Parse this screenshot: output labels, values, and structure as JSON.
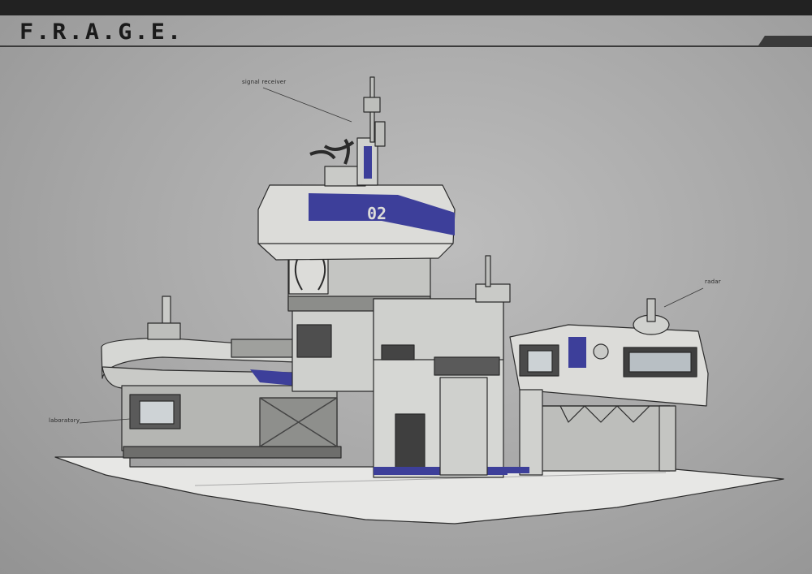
{
  "header": {
    "title": "F.R.A.G.E."
  },
  "building": {
    "module_number": "02"
  },
  "callouts": {
    "signal_receiver": "signal receiver",
    "radar": "radar",
    "laboratory": "laboratory"
  },
  "colors": {
    "accent": "#3d3f9a",
    "panel": "#d8d9d6",
    "shade": "#a9aaa7",
    "ink": "#2b2b2b"
  }
}
